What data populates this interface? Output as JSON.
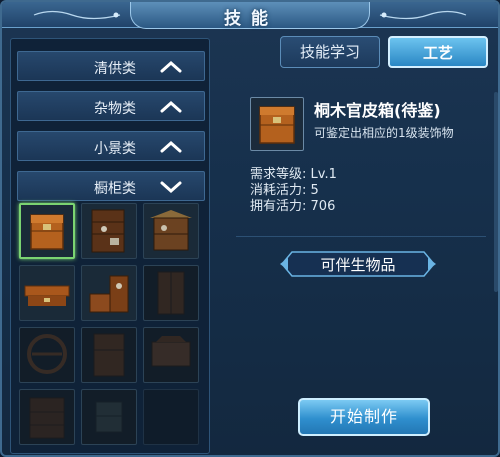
{
  "window": {
    "title": "技能"
  },
  "categories": [
    {
      "label": "清供类",
      "state": "expanded",
      "chevron": "chevron-up-icon"
    },
    {
      "label": "杂物类",
      "state": "expanded",
      "chevron": "chevron-up-icon"
    },
    {
      "label": "小景类",
      "state": "expanded",
      "chevron": "chevron-up-icon"
    },
    {
      "label": "橱柜类",
      "state": "collapsed",
      "chevron": "chevron-down-icon"
    }
  ],
  "tabs": {
    "skill_label": "技能学习",
    "craft_label": "工艺",
    "active": "工艺"
  },
  "item": {
    "name": "桐木官皮箱(待鉴)",
    "desc": "可鉴定出相应的1级装饰物",
    "level_label": "需求等级:",
    "level_value": "Lv.1",
    "cost_label": "消耗活力:",
    "cost_value": "5",
    "own_label": "拥有活力:",
    "own_value": "706"
  },
  "companion_label": "可伴生物品",
  "start_button": "开始制作",
  "grid_items": [
    {
      "icon": "leather-chest-icon",
      "state": "selected"
    },
    {
      "icon": "curio-shelf-icon",
      "state": "available"
    },
    {
      "icon": "tea-cabinet-icon",
      "state": "available"
    },
    {
      "icon": "low-table-icon",
      "state": "available"
    },
    {
      "icon": "stepped-shelf-icon",
      "state": "available"
    },
    {
      "icon": "tall-cabinet-icon",
      "state": "locked"
    },
    {
      "icon": "round-shelf-icon",
      "state": "locked"
    },
    {
      "icon": "wardrobe-icon",
      "state": "locked"
    },
    {
      "icon": "display-stand-icon",
      "state": "locked"
    },
    {
      "icon": "bookshelf-icon",
      "state": "locked"
    },
    {
      "icon": "small-cabinet-icon",
      "state": "locked"
    },
    {
      "icon": "empty-slot",
      "state": "empty"
    }
  ],
  "colors": {
    "accent": "#2f8fce",
    "selected_border": "#7bd472",
    "panel": "#0f2238"
  }
}
